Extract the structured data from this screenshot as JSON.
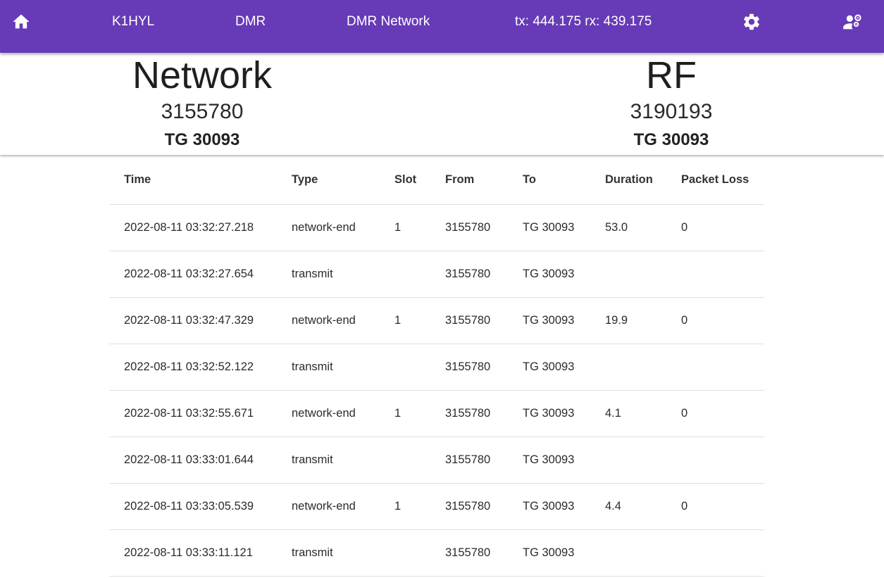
{
  "topbar": {
    "callsign": "K1HYL",
    "mode": "DMR",
    "network": "DMR Network",
    "frequency": "tx: 444.175 rx: 439.175",
    "background": "#673ab7"
  },
  "hero": {
    "network": {
      "title": "Network",
      "id": "3155780",
      "tg": "TG 30093"
    },
    "rf": {
      "title": "RF",
      "id": "3190193",
      "tg": "TG 30093"
    }
  },
  "table": {
    "columns": [
      "Time",
      "Type",
      "Slot",
      "From",
      "To",
      "Duration",
      "Packet Loss"
    ],
    "rows": [
      [
        "2022-08-11 03:32:27.218",
        "network-end",
        "1",
        "3155780",
        "TG 30093",
        "53.0",
        "0"
      ],
      [
        "2022-08-11 03:32:27.654",
        "transmit",
        "",
        "3155780",
        "TG 30093",
        "",
        ""
      ],
      [
        "2022-08-11 03:32:47.329",
        "network-end",
        "1",
        "3155780",
        "TG 30093",
        "19.9",
        "0"
      ],
      [
        "2022-08-11 03:32:52.122",
        "transmit",
        "",
        "3155780",
        "TG 30093",
        "",
        ""
      ],
      [
        "2022-08-11 03:32:55.671",
        "network-end",
        "1",
        "3155780",
        "TG 30093",
        "4.1",
        "0"
      ],
      [
        "2022-08-11 03:33:01.644",
        "transmit",
        "",
        "3155780",
        "TG 30093",
        "",
        ""
      ],
      [
        "2022-08-11 03:33:05.539",
        "network-end",
        "1",
        "3155780",
        "TG 30093",
        "4.4",
        "0"
      ],
      [
        "2022-08-11 03:33:11.121",
        "transmit",
        "",
        "3155780",
        "TG 30093",
        "",
        ""
      ]
    ]
  },
  "icons": {
    "home": "home-icon",
    "settings": "gear-icon",
    "account": "user-settings-icon"
  }
}
